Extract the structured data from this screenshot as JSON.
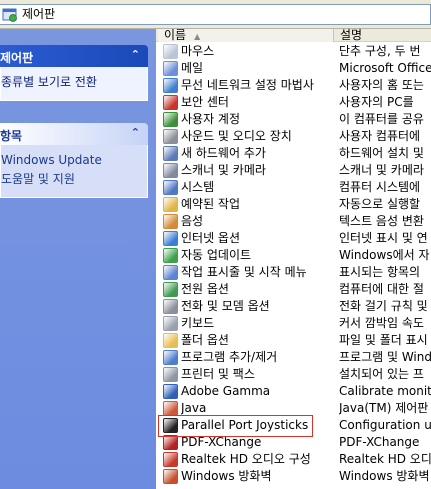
{
  "address": {
    "text": "제어판",
    "icon": "control-panel-icon"
  },
  "left_pane": {
    "panels": [
      {
        "title": "제어판",
        "links": [
          "종류별 보기로 전환"
        ]
      },
      {
        "title": "항목",
        "links": [
          "Windows Update",
          "도움말 및 지원"
        ]
      }
    ]
  },
  "columns": {
    "name": "이름",
    "description": "설명"
  },
  "items": [
    {
      "name": "마우스",
      "desc": "단추 구성, 두 번",
      "icon": "mouse-icon",
      "color": "#b9c4d6"
    },
    {
      "name": "메일",
      "desc": "Microsoft Office",
      "icon": "mail-icon",
      "color": "#6b8fd8"
    },
    {
      "name": "무선 네트워크 설정 마법사",
      "desc": "사용자의 홈 또는",
      "icon": "wireless-network-icon",
      "color": "#3f7fcf"
    },
    {
      "name": "보안 센터",
      "desc": "사용자의 PC를",
      "icon": "security-center-icon",
      "color": "#c8352a"
    },
    {
      "name": "사용자 계정",
      "desc": "이 컴퓨터를 공유",
      "icon": "user-accounts-icon",
      "color": "#3c8f3a"
    },
    {
      "name": "사운드 및 오디오 장치",
      "desc": "사용자 컴퓨터에",
      "icon": "sound-icon",
      "color": "#8a8f99"
    },
    {
      "name": "새 하드웨어 추가",
      "desc": "하드웨어 설치 및",
      "icon": "add-hardware-icon",
      "color": "#5a7ab8"
    },
    {
      "name": "스캐너 및 카메라",
      "desc": "스캐너 및 카메라",
      "icon": "scanner-camera-icon",
      "color": "#7f8aa0"
    },
    {
      "name": "시스템",
      "desc": "컴퓨터 시스템에",
      "icon": "system-icon",
      "color": "#4f77c4"
    },
    {
      "name": "예약된 작업",
      "desc": "자동으로 실행할",
      "icon": "scheduled-tasks-icon",
      "color": "#e0b448"
    },
    {
      "name": "음성",
      "desc": "텍스트 음성 변환",
      "icon": "speech-icon",
      "color": "#d48a3a"
    },
    {
      "name": "인터넷 옵션",
      "desc": "인터넷 표시 및 연",
      "icon": "internet-options-icon",
      "color": "#3b7fd3"
    },
    {
      "name": "자동 업데이트",
      "desc": "Windows에서 자",
      "icon": "automatic-updates-icon",
      "color": "#3da14a"
    },
    {
      "name": "작업 표시줄 및 시작 메뉴",
      "desc": "표시되는 항목의",
      "icon": "taskbar-icon",
      "color": "#5b84d3"
    },
    {
      "name": "전원 옵션",
      "desc": "컴퓨터에 대한 절",
      "icon": "power-options-icon",
      "color": "#3e9a52"
    },
    {
      "name": "전화 및 모뎀 옵션",
      "desc": "전화 걸기 규칙 및",
      "icon": "phone-modem-icon",
      "color": "#8a8f99"
    },
    {
      "name": "키보드",
      "desc": "커서 깜박임 속도",
      "icon": "keyboard-icon",
      "color": "#9aa1ad"
    },
    {
      "name": "폴더 옵션",
      "desc": "파일 및 폴더 표시",
      "icon": "folder-options-icon",
      "color": "#e6c04e"
    },
    {
      "name": "프로그램 추가/제거",
      "desc": "프로그램 및 Wind",
      "icon": "add-remove-programs-icon",
      "color": "#4e7fcc"
    },
    {
      "name": "프린터 및 팩스",
      "desc": "설치되어 있는 프",
      "icon": "printers-faxes-icon",
      "color": "#8f96a3"
    },
    {
      "name": "Adobe Gamma",
      "desc": "Calibrate monito",
      "icon": "adobe-gamma-icon",
      "color": "#2f5fb8"
    },
    {
      "name": "Java",
      "desc": "Java(TM) 제어판",
      "icon": "java-icon",
      "color": "#d0573a"
    },
    {
      "name": "Parallel Port Joysticks",
      "desc": "Configuration uti",
      "icon": "joystick-icon",
      "color": "#222222"
    },
    {
      "name": "PDF-XChange",
      "desc": "PDF-XChange",
      "icon": "pdf-xchange-icon",
      "color": "#b32222"
    },
    {
      "name": "Realtek HD 오디오 구성",
      "desc": "Realtek HD 오디",
      "icon": "realtek-audio-icon",
      "color": "#c73a2a"
    },
    {
      "name": "Windows 방화벽",
      "desc": "Windows 방화벽",
      "icon": "firewall-icon",
      "color": "#c5502c"
    }
  ]
}
